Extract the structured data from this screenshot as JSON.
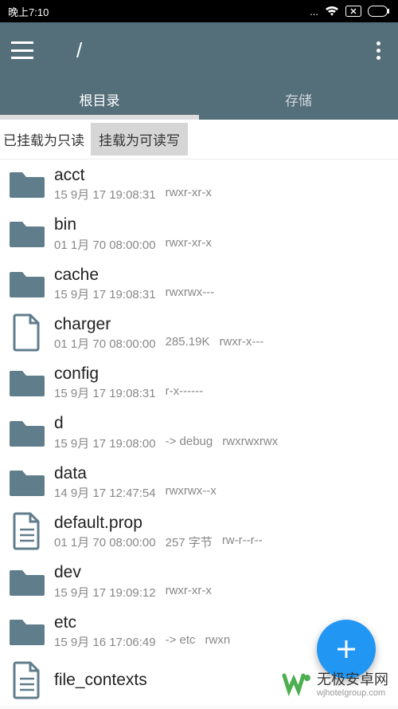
{
  "status": {
    "time": "晚上7:10"
  },
  "header": {
    "path": "/"
  },
  "tabs": [
    {
      "label": "根目录",
      "active": true
    },
    {
      "label": "存储",
      "active": false
    }
  ],
  "mount": {
    "status": "已挂载为只读",
    "button": "挂载为可读写"
  },
  "items": [
    {
      "type": "folder",
      "name": "acct",
      "date": "15 9月 17 19:08:31",
      "size": "",
      "link": "",
      "perm": "rwxr-xr-x"
    },
    {
      "type": "folder",
      "name": "bin",
      "date": "01 1月 70 08:00:00",
      "size": "",
      "link": "",
      "perm": "rwxr-xr-x"
    },
    {
      "type": "folder",
      "name": "cache",
      "date": "15 9月 17 19:08:31",
      "size": "",
      "link": "",
      "perm": "rwxrwx---"
    },
    {
      "type": "file",
      "name": "charger",
      "date": "01 1月 70 08:00:00",
      "size": "285.19K",
      "link": "",
      "perm": "rwxr-x---"
    },
    {
      "type": "folder",
      "name": "config",
      "date": "15 9月 17 19:08:31",
      "size": "",
      "link": "",
      "perm": "r-x------"
    },
    {
      "type": "folder",
      "name": "d",
      "date": "15 9月 17 19:08:00",
      "size": "",
      "link": "-> debug",
      "perm": "rwxrwxrwx"
    },
    {
      "type": "folder",
      "name": "data",
      "date": "14 9月 17 12:47:54",
      "size": "",
      "link": "",
      "perm": "rwxrwx--x"
    },
    {
      "type": "text",
      "name": "default.prop",
      "date": "01 1月 70 08:00:00",
      "size": "257 字节",
      "link": "",
      "perm": "rw-r--r--"
    },
    {
      "type": "folder",
      "name": "dev",
      "date": "15 9月 17 19:09:12",
      "size": "",
      "link": "",
      "perm": "rwxr-xr-x"
    },
    {
      "type": "folder",
      "name": "etc",
      "date": "15 9月 16 17:06:49",
      "size": "",
      "link": "-> etc",
      "perm": "rwxn"
    },
    {
      "type": "text",
      "name": "file_contexts",
      "date": "",
      "size": "",
      "link": "",
      "perm": ""
    }
  ],
  "watermark": {
    "title": "无极安卓网",
    "url": "wjhotelgroup.com"
  }
}
